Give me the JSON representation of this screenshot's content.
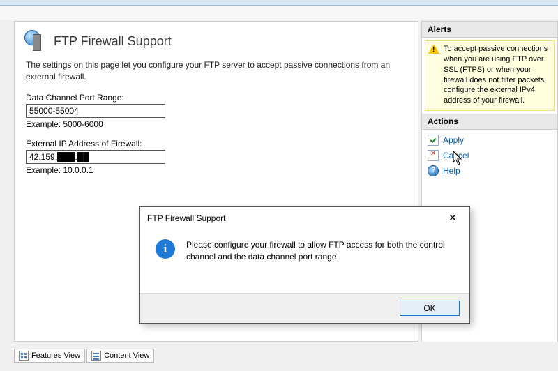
{
  "page": {
    "title": "FTP Firewall Support",
    "description": "The settings on this page let you configure your FTP server to accept passive connections from an external firewall."
  },
  "fields": {
    "port_range": {
      "label": "Data Channel Port Range:",
      "value": "55000-55004",
      "example": "Example: 5000-6000"
    },
    "external_ip": {
      "label": "External IP Address of Firewall:",
      "value": "42.159.███.██",
      "example": "Example: 10.0.0.1"
    }
  },
  "alerts": {
    "header": "Alerts",
    "text": "To accept passive connections when you are using FTP over SSL (FTPS) or when your firewall does not filter packets, configure the external IPv4 address of your firewall."
  },
  "actions": {
    "header": "Actions",
    "apply": "Apply",
    "cancel": "Cancel",
    "help": "Help"
  },
  "dialog": {
    "title": "FTP Firewall Support",
    "message": "Please configure your firewall to allow FTP access for both the control channel and the data channel port range.",
    "ok": "OK",
    "info_glyph": "i"
  },
  "tabs": {
    "features": "Features View",
    "content": "Content View"
  }
}
